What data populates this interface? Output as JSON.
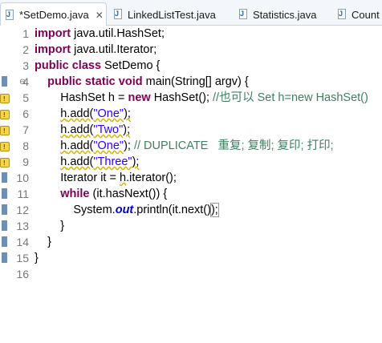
{
  "tabs": [
    {
      "label": "*SetDemo.java",
      "active": true,
      "close": "✕"
    },
    {
      "label": "LinkedListTest.java",
      "active": false
    },
    {
      "label": "Statistics.java",
      "active": false
    },
    {
      "label": "Count",
      "active": false
    }
  ],
  "editor": {
    "line_numbers": [
      "1",
      "2",
      "3",
      "4",
      "5",
      "6",
      "7",
      "8",
      "9",
      "10",
      "11",
      "12",
      "13",
      "14",
      "15",
      "16"
    ],
    "lines": {
      "l1": {
        "kw": "import",
        "rest": " java.util.HashSet;"
      },
      "l2": {
        "kw": "import",
        "rest": " java.util.Iterator;"
      },
      "l3": {
        "kw1": "public",
        "kw2": "class",
        "rest": " SetDemo {"
      },
      "l4": {
        "kw1": "public",
        "kw2": "static",
        "kw3": "void",
        "rest": " main(String[] argv) {"
      },
      "l5": {
        "pre": "HashSet h = ",
        "kw": "new",
        "mid": " HashSet(); ",
        "comment": "//也可以 Set h=new HashSet()"
      },
      "l6": {
        "var": "h",
        "call": ".add(",
        "str": "\"One\"",
        "end": ");"
      },
      "l7": {
        "var": "h",
        "call": ".add(",
        "str": "\"Two\"",
        "end": ");"
      },
      "l8": {
        "var": "h",
        "call": ".add(",
        "str": "\"One\"",
        "end": "); ",
        "comment": "// DUPLICATE   重复; 复制; 复印; 打印;"
      },
      "l9": {
        "var": "h",
        "call": ".add(",
        "str": "\"Three\"",
        "end": ");"
      },
      "l10": {
        "pre": "Iterator it = ",
        "var": "h",
        "rest": ".iterator();"
      },
      "l11": {
        "kw": "while",
        "rest": " (it.hasNext()) {"
      },
      "l12": {
        "pre": "System.",
        "field": "out",
        "rest": ".println(it.next()",
        "close": ");"
      },
      "l13": {
        "rest": "}"
      },
      "l14": {
        "rest": "}"
      },
      "l15": {
        "rest": "}"
      }
    },
    "fold_markers": [
      "⊖",
      "⊖"
    ]
  },
  "colors": {
    "keyword": "#7f0055",
    "string": "#2a00ff",
    "comment": "#3f7f5f",
    "field": "#0000c0",
    "tab_bar": "#f3f6fa"
  }
}
